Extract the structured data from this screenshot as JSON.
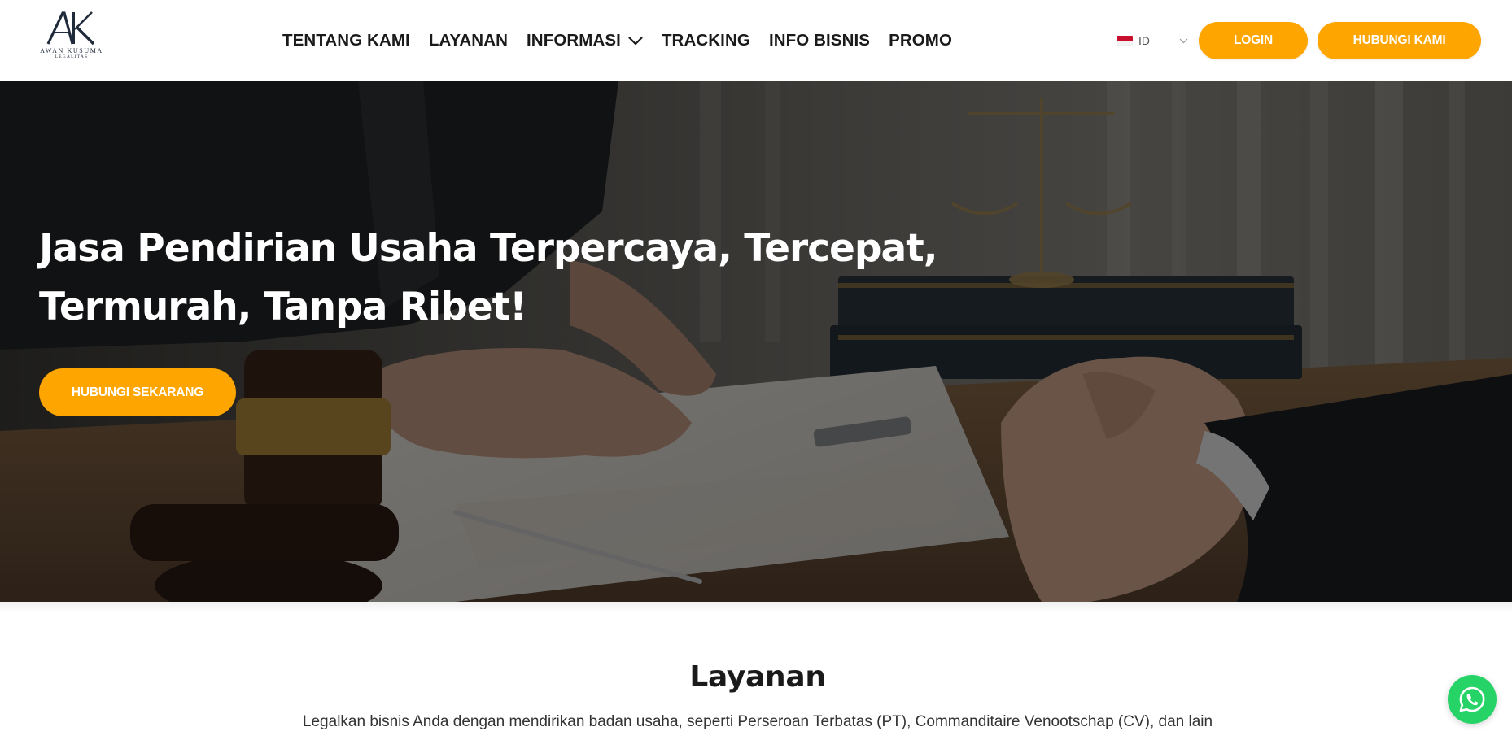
{
  "brand": {
    "monogram": "AK",
    "name": "AWAN KUSUMA",
    "tagline": "LEGALITAS"
  },
  "nav": {
    "items": [
      {
        "label": "TENTANG KAMI"
      },
      {
        "label": "LAYANAN"
      },
      {
        "label": "INFORMASI",
        "icon": "chevron-down-icon"
      },
      {
        "label": "TRACKING"
      },
      {
        "label": "INFO BISNIS"
      },
      {
        "label": "PROMO"
      }
    ]
  },
  "language": {
    "code": "ID",
    "flag": "indonesia-flag-icon"
  },
  "header_buttons": {
    "login": "LOGIN",
    "contact": "HUBUNGI KAMI"
  },
  "hero": {
    "title_line1": "Jasa Pendirian Usaha Terpercaya, Tercepat,",
    "title_line2": "Termurah, Tanpa Ribet!",
    "cta": "HUBUNGI SEKARANG"
  },
  "services": {
    "title": "Layanan",
    "description": "Legalkan bisnis Anda dengan mendirikan badan usaha, seperti Perseroan Terbatas (PT), Commanditaire Venootschap (CV), dan lain"
  },
  "floating": {
    "icon": "whatsapp-icon"
  },
  "colors": {
    "accent": "#fea500",
    "text_dark": "#1a1a1a",
    "whatsapp": "#25d366",
    "logo_navy": "#1f2a3a"
  }
}
